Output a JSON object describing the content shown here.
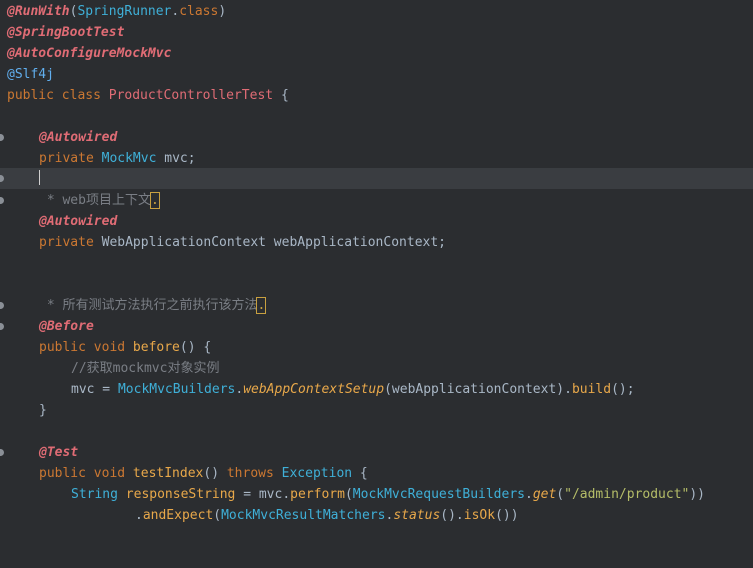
{
  "editor": {
    "lines": {
      "l1": {
        "a": "@RunWith",
        "b": "(",
        "c": "SpringRunner",
        "d": ".",
        "e": "class",
        "f": ")"
      },
      "l2": {
        "a": "@SpringBootTest"
      },
      "l3": {
        "a": "@AutoConfigureMockMvc"
      },
      "l4": {
        "a": "@Slf4j"
      },
      "l5": {
        "a": "public class ",
        "b": "ProductControllerTest",
        "c": " {"
      },
      "l7": {
        "a": "@Autowired"
      },
      "l8": {
        "a": "private ",
        "b": "MockMvc",
        "c": " mvc;"
      },
      "l10": {
        "a": " * web项目上下文",
        "b": "."
      },
      "l11": {
        "a": "@Autowired"
      },
      "l12": {
        "a": "private ",
        "b": "WebApplicationContext webApplicationContext;"
      },
      "l15": {
        "a": " * 所有测试方法执行之前执行该方法",
        "b": "."
      },
      "l16": {
        "a": "@Before"
      },
      "l17": {
        "a": "public void ",
        "b": "before",
        "c": "() {"
      },
      "l18": {
        "a": "//获取mockmvc对象实例"
      },
      "l19": {
        "a": "mvc = ",
        "b": "MockMvcBuilders",
        "c": ".",
        "d": "webAppContextSetup",
        "e": "(webApplicationContext).",
        "f": "build",
        "g": "();"
      },
      "l20": {
        "a": "}"
      },
      "l22": {
        "a": "@Test"
      },
      "l23": {
        "a": "public void ",
        "b": "testIndex",
        "c": "() ",
        "d": "throws ",
        "e": "Exception",
        "f": " {"
      },
      "l24": {
        "a": "String ",
        "b": "responseString",
        "c": " = mvc.",
        "d": "perform",
        "e": "(",
        "f": "MockMvcRequestBuilders",
        "g": ".",
        "h": "get",
        "i": "(",
        "j": "\"/admin/product\"",
        "k": "))"
      },
      "l25": {
        "a": ".",
        "b": "andExpect",
        "c": "(",
        "d": "MockMvcResultMatchers",
        "e": ".",
        "f": "status",
        "g": "().",
        "h": "isOk",
        "i": "())"
      }
    }
  },
  "colors": {
    "background": "#2b2d30",
    "current_line": "#3a3d41",
    "annotation": "#e06c75",
    "keyword": "#cc7832",
    "type": "#3fb0d8",
    "method": "#e8a84a",
    "string": "#b5bd68",
    "comment": "#7a7e85"
  }
}
